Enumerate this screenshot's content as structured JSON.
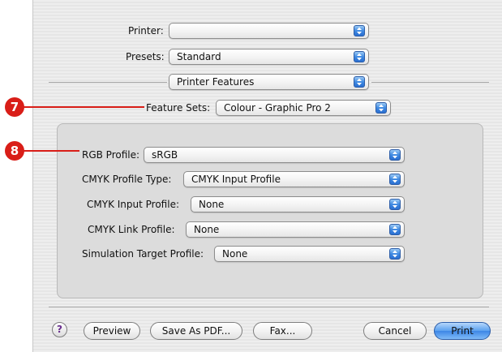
{
  "printer": {
    "label": "Printer:",
    "value": ""
  },
  "presets": {
    "label": "Presets:",
    "value": "Standard"
  },
  "panel": {
    "value": "Printer Features"
  },
  "feature_sets": {
    "label": "Feature Sets:",
    "value": "Colour - Graphic Pro 2"
  },
  "profiles": [
    {
      "label": "RGB Profile:",
      "value": "sRGB"
    },
    {
      "label": "CMYK Profile Type:",
      "value": "CMYK Input Profile"
    },
    {
      "label": "CMYK Input Profile:",
      "value": "None"
    },
    {
      "label": "CMYK Link Profile:",
      "value": "None"
    },
    {
      "label": "Simulation Target Profile:",
      "value": "None"
    }
  ],
  "callouts": {
    "first": "7",
    "second": "8",
    "color": "#d91e18"
  },
  "buttons": {
    "help": "?",
    "preview": "Preview",
    "save_pdf": "Save As PDF...",
    "fax": "Fax...",
    "cancel": "Cancel",
    "print": "Print"
  },
  "icons": {
    "popup_arrow": "updown-arrows-icon",
    "help": "question-mark-icon"
  }
}
